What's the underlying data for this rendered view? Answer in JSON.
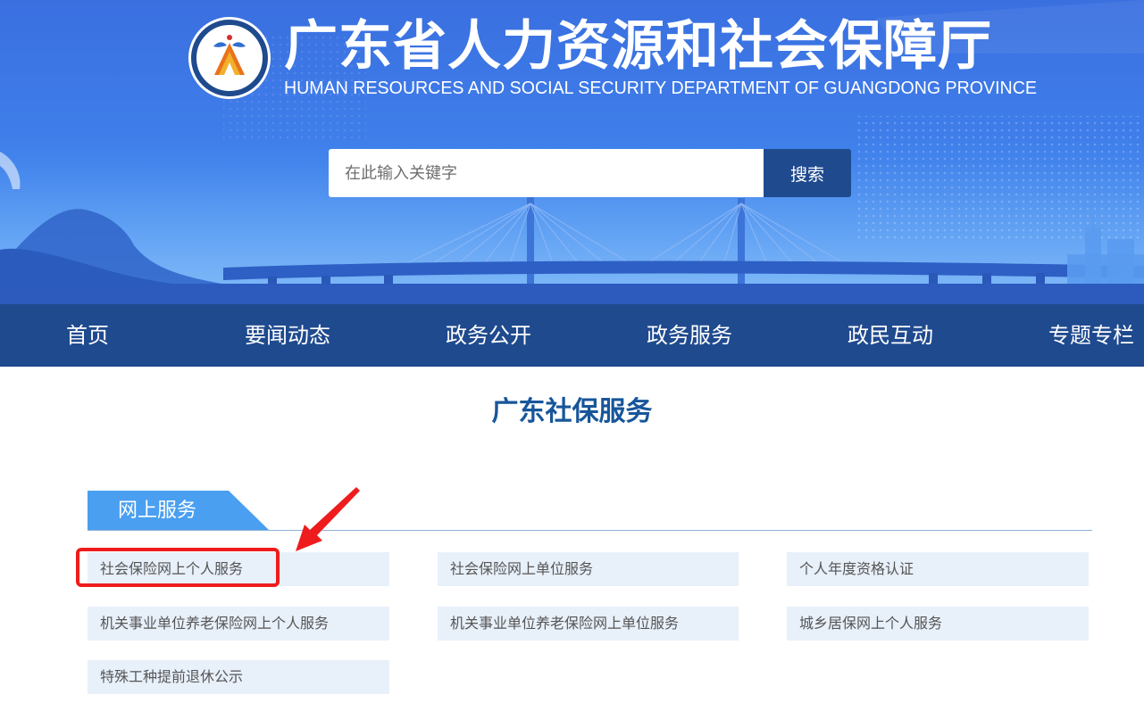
{
  "header": {
    "title_cn": "广东省人力资源和社会保障厅",
    "title_en": "HUMAN RESOURCES AND SOCIAL SECURITY DEPARTMENT OF GUANGDONG PROVINCE",
    "logo_icon": "department-emblem-icon"
  },
  "search": {
    "placeholder": "在此输入关键字",
    "value": "",
    "button_label": "搜索"
  },
  "nav": {
    "items": [
      {
        "label": "首页"
      },
      {
        "label": "要闻动态"
      },
      {
        "label": "政务公开"
      },
      {
        "label": "政务服务"
      },
      {
        "label": "政民互动"
      },
      {
        "label": "专题专栏"
      }
    ]
  },
  "main": {
    "title": "广东社保服务",
    "section": {
      "label": "网上服务",
      "links": [
        {
          "label": "社会保险网上个人服务"
        },
        {
          "label": "社会保险网上单位服务"
        },
        {
          "label": "个人年度资格认证"
        },
        {
          "label": "机关事业单位养老保险网上个人服务"
        },
        {
          "label": "机关事业单位养老保险网上单位服务"
        },
        {
          "label": "城乡居保网上个人服务"
        },
        {
          "label": "特殊工种提前退休公示"
        }
      ]
    }
  },
  "colors": {
    "nav_bg": "#1f4a8e",
    "title_blue": "#17569a",
    "tab_blue": "#4a9ff0",
    "link_bg": "#e8f0fa",
    "annotation_red": "#ee1c1c"
  }
}
